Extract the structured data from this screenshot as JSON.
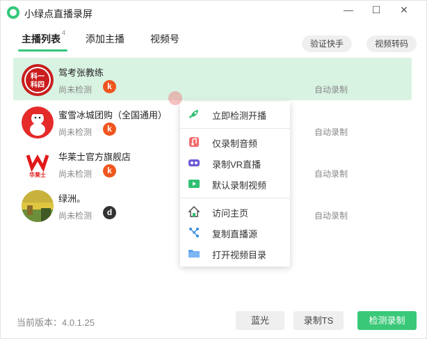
{
  "app": {
    "title": "小绿点直播录屏"
  },
  "window_controls": {
    "minimize": "—",
    "maximize": "☐",
    "close": "✕"
  },
  "tabs": [
    {
      "label": "主播列表",
      "badge": "4",
      "active": true
    },
    {
      "label": "添加主播"
    },
    {
      "label": "视频号"
    }
  ],
  "top_buttons": {
    "verify": "验证快手",
    "transcode": "视频转码"
  },
  "streamers": [
    {
      "name": "驾考张教练",
      "status": "尚未检测",
      "platform": "k",
      "platform_color": "#f0561e",
      "mode": "自动录制",
      "avatar_text": [
        "科一",
        "科四"
      ]
    },
    {
      "name": "蜜雪冰城团购（全国通用）",
      "status": "尚未检测",
      "platform": "k",
      "platform_color": "#f0561e",
      "mode": "自动录制"
    },
    {
      "name": "华莱士官方旗舰店",
      "status": "尚未检测",
      "platform": "k",
      "platform_color": "#f0561e",
      "mode": "自动录制",
      "avatar_text": [
        "华莱士"
      ]
    },
    {
      "name": "绿洲。",
      "status": "尚未检测",
      "platform": "d",
      "platform_color": "#333333",
      "mode": "自动录制"
    }
  ],
  "context_menu": {
    "items": [
      {
        "label": "立即检测开播",
        "icon": "rocket-icon"
      },
      {
        "label": "仅录制音频",
        "icon": "music-icon"
      },
      {
        "label": "录制VR直播",
        "icon": "vr-icon"
      },
      {
        "label": "默认录制视频",
        "icon": "video-icon"
      },
      {
        "label": "访问主页",
        "icon": "home-icon"
      },
      {
        "label": "复制直播源",
        "icon": "share-icon"
      },
      {
        "label": "打开视频目录",
        "icon": "folder-icon"
      }
    ]
  },
  "footer": {
    "version": "当前版本：4.0.1.25",
    "bluray": "蓝光",
    "record_ts": "录制TS",
    "check_record": "检测录制"
  },
  "colors": {
    "accent": "#39c878",
    "selected_row": "#d9f3e3"
  }
}
